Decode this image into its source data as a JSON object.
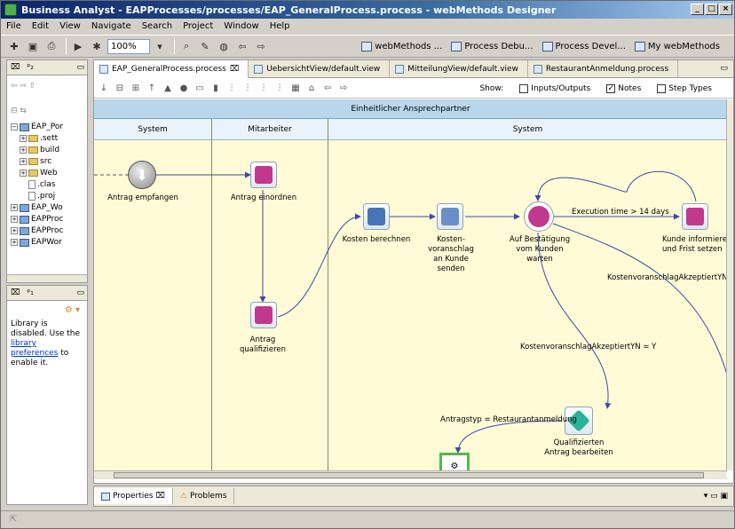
{
  "window": {
    "title": "Business Analyst - EAPProcesses/processes/EAP_GeneralProcess.process - webMethods Designer"
  },
  "menu": [
    "File",
    "Edit",
    "View",
    "Navigate",
    "Search",
    "Project",
    "Window",
    "Help"
  ],
  "toolbar": {
    "zoom": "100%",
    "perspectives": [
      "webMethods ...",
      "Process Debu...",
      "Process Devel...",
      "My webMethods"
    ]
  },
  "navigator": {
    "tree": [
      {
        "label": "EAP_Por"
      },
      {
        "label": ".sett"
      },
      {
        "label": "build"
      },
      {
        "label": "src"
      },
      {
        "label": "Web"
      },
      {
        "label": ".clas"
      },
      {
        "label": ".proj"
      },
      {
        "label": "EAP_Wo"
      },
      {
        "label": "EAPProc"
      },
      {
        "label": "EAPProc"
      },
      {
        "label": "EAPWor"
      }
    ]
  },
  "library": {
    "message_start": "Library is disabled. Use the ",
    "link": "library preferences",
    "message_end": " to enable it."
  },
  "editor": {
    "tabs": [
      {
        "label": "EAP_GeneralProcess.process"
      },
      {
        "label": "UebersichtView/default.view"
      },
      {
        "label": "MitteilungView/default.view"
      },
      {
        "label": "RestaurantAnmeldung.process"
      }
    ],
    "show_label": "Show:",
    "show_options": [
      {
        "label": "Inputs/Outputs",
        "checked": false
      },
      {
        "label": "Notes",
        "checked": true
      },
      {
        "label": "Step Types",
        "checked": false
      }
    ]
  },
  "process": {
    "pool": "Einheitlicher Ansprechpartner",
    "lanes": [
      "System",
      "Mitarbeiter",
      "System"
    ],
    "steps": {
      "receive": "Antrag empfangen",
      "classify": "Antrag einordnen",
      "qualify": "Antrag qualifizieren",
      "costs": "Kosten berechnen",
      "send_quote": "Kosten-voranschlag an Kunde senden",
      "wait": "Auf Bestätigung vom Kunden warten",
      "inform": "Kunde informieren und Frist setzen",
      "process_qualified": "Qualifizierten Antrag bearbeiten"
    },
    "conditions": {
      "timeout": "Execution time > 14 days",
      "accepted_n": "KostenvoranschlagAkzeptiertYN =",
      "accepted_y": "KostenvoranschlagAkzeptiertYN = Y",
      "type": "Antragstyp = Restaurantanmeldung"
    }
  },
  "bottom": {
    "tabs": [
      "Properties",
      "Problems"
    ]
  },
  "colors": {
    "canvas": "#fffbd6",
    "pool_header": "#b9d7ec",
    "task_icon": "#c0398e",
    "gateway": "#2bb39a",
    "edge": "#3b4aa8",
    "selected": "#53b84a"
  }
}
